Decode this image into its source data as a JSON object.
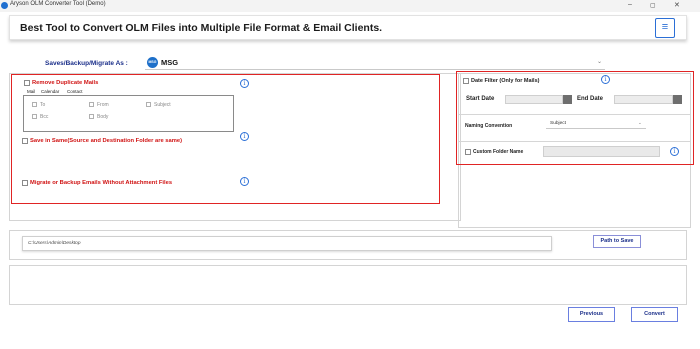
{
  "window": {
    "title": "Aryson OLM Converter Tool (Demo)",
    "controls": {
      "minimize": "–",
      "maximize": "▢",
      "close": "✕"
    }
  },
  "header": {
    "title": "Best Tool to Convert OLM Files into Multiple File Format & Email Clients.",
    "menu_icon": "≡"
  },
  "saves": {
    "label": "Saves/Backup/Migrate As :",
    "selected_value": "MSG",
    "format_icon_text": "MSG",
    "chevron": "⌄"
  },
  "left_panel": {
    "remove_duplicates_label": "Remove Duplicate Mails",
    "tabs": [
      "Mail",
      "Calendar",
      "Contact"
    ],
    "fields": [
      "To",
      "From",
      "Subject",
      "Bcc",
      "Body"
    ],
    "save_in_same_label": "Save in Same(Source and Destination Folder are same)",
    "without_attachment_label": "Migrate or Backup Emails Without Attachment Files",
    "info_icon": "i"
  },
  "right_panel": {
    "date_filter_label": "Date Filter  (Only for Mails)",
    "start_date_label": "Start Date",
    "end_date_label": "End Date",
    "naming_convention_label": "Naming Convention",
    "naming_convention_value": "Subject",
    "naming_chevron": "⌄",
    "custom_folder_label": "Custom Folder Name",
    "info_icon": "i"
  },
  "path": {
    "value": "C:\\Users\\Admin\\Desktop",
    "button_label": "Path to Save"
  },
  "buttons": {
    "previous": "Previous",
    "convert": "Convert"
  },
  "colors": {
    "accent_blue": "#2b6fd6",
    "highlight_red": "#e02424",
    "label_navy": "#1b2f8a",
    "option_red": "#d01414"
  }
}
